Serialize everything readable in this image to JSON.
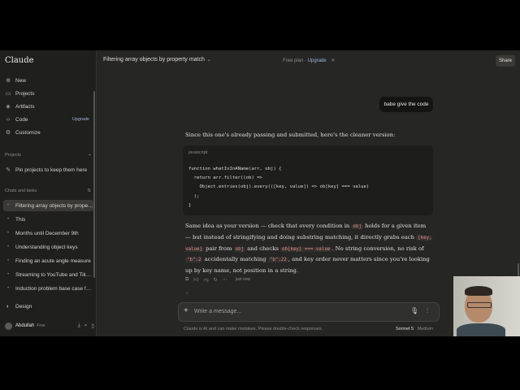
{
  "sidebar": {
    "brand": "Claude",
    "nav": [
      {
        "label": "New",
        "icon": "plus-icon"
      },
      {
        "label": "Projects",
        "icon": "folder-icon"
      },
      {
        "label": "Artifacts",
        "icon": "artifacts-icon"
      },
      {
        "label": "Code",
        "icon": "code-icon",
        "badge": "Upgrade"
      },
      {
        "label": "Customize",
        "icon": "customize-icon"
      }
    ],
    "projects_header": "Projects",
    "projects_hint": "Pin projects to keep them here",
    "chats_header": "Chats and tasks",
    "chats": [
      "Filtering array objects by property",
      "This",
      "Months until December 9th",
      "Understanding object keys",
      "Finding an acute angle measure",
      "Streaming to YouTube and TikTok s",
      "Induction problem base case form"
    ],
    "design_label": "Design",
    "user_name": "Abdullah",
    "user_plan": "Free"
  },
  "header": {
    "title": "Filtering array objects by property match",
    "free_plan": "Free plan",
    "separator": "·",
    "upgrade": "Upgrade",
    "share": "Share"
  },
  "conversation": {
    "user_message": "babe give the code",
    "intro": "Since this one's already passing and submitted, here's the cleaner version:",
    "code_lang": "javascript",
    "code_lines": [
      "function whatIsInAName(arr, obj) {",
      "  return arr.filter((ob) =>",
      "    Object.entries(obj).every(([key, value]) => ob[key] === value)",
      "  );",
      "}"
    ],
    "explanation": {
      "p1": "Same idea as your version — check that every condition in",
      "c1": "obj",
      "p2": "holds for a given item — but instead of stringifying and doing substring matching, it directly grabs each",
      "c2": "[key, value]",
      "p3": "pair from",
      "c3": "obj",
      "p4": "and checks",
      "c4": "ob[key] === value",
      "p5": ". No string conversion, no risk of",
      "c5": "\"b\":2",
      "p6": "accidentally matching",
      "c6": "\"b\":22",
      "p7": ", and key order never matters since you're looking up by key name, not position in a string."
    },
    "timestamp": "just now"
  },
  "composer": {
    "placeholder": "Write a message...",
    "disclaimer": "Claude is AI and can make mistakes. Please double-check responses.",
    "model": "Sonnet 5",
    "mode": "Medium"
  }
}
